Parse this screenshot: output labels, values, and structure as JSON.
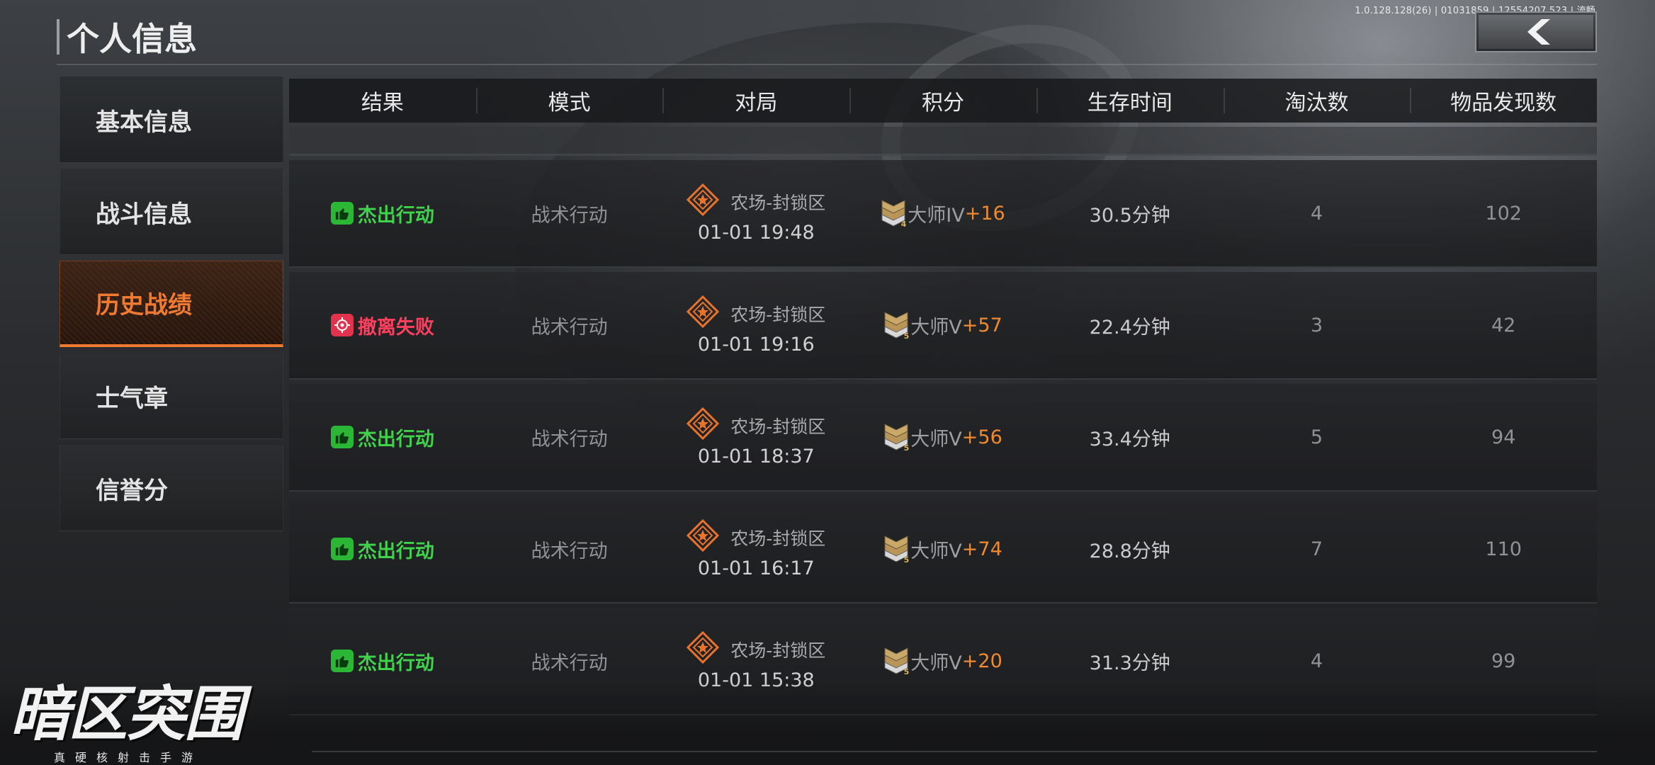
{
  "version_text": "1.0.128.128(26) | 01031859 | 12554207.523 | 流畅",
  "header": {
    "title": "个人信息"
  },
  "sidebar": {
    "items": [
      {
        "label": "基本信息",
        "active": false
      },
      {
        "label": "战斗信息",
        "active": false
      },
      {
        "label": "历史战绩",
        "active": true
      },
      {
        "label": "士气章",
        "active": false
      },
      {
        "label": "信誉分",
        "active": false
      }
    ]
  },
  "table": {
    "columns": [
      "结果",
      "模式",
      "对局",
      "积分",
      "生存时间",
      "淘汰数",
      "物品发现数"
    ],
    "rows": [
      {
        "result": "杰出行动",
        "result_type": "success",
        "mode": "战术行动",
        "map": "农场-封锁区",
        "time": "01-01 19:48",
        "rank": "大师IV",
        "rank_level": "4",
        "delta": "+16",
        "survival": "30.5分钟",
        "kills": "4",
        "items": "102"
      },
      {
        "result": "撤离失败",
        "result_type": "fail",
        "mode": "战术行动",
        "map": "农场-封锁区",
        "time": "01-01 19:16",
        "rank": "大师V",
        "rank_level": "5",
        "delta": "+57",
        "survival": "22.4分钟",
        "kills": "3",
        "items": "42"
      },
      {
        "result": "杰出行动",
        "result_type": "success",
        "mode": "战术行动",
        "map": "农场-封锁区",
        "time": "01-01 18:37",
        "rank": "大师V",
        "rank_level": "5",
        "delta": "+56",
        "survival": "33.4分钟",
        "kills": "5",
        "items": "94"
      },
      {
        "result": "杰出行动",
        "result_type": "success",
        "mode": "战术行动",
        "map": "农场-封锁区",
        "time": "01-01 16:17",
        "rank": "大师V",
        "rank_level": "5",
        "delta": "+74",
        "survival": "28.8分钟",
        "kills": "7",
        "items": "110"
      },
      {
        "result": "杰出行动",
        "result_type": "success",
        "mode": "战术行动",
        "map": "农场-封锁区",
        "time": "01-01 15:38",
        "rank": "大师V",
        "rank_level": "5",
        "delta": "+20",
        "survival": "31.3分钟",
        "kills": "4",
        "items": "99"
      }
    ]
  },
  "logo": {
    "title": "暗区突围",
    "subtitle": "真硬核射击手游"
  },
  "colors": {
    "accent": "#f07a32",
    "success": "#3ed34a",
    "fail": "#ff3f5e",
    "delta": "#f08a30"
  },
  "icons": {
    "back": "chevron-left-icon",
    "success": "thumbs-up-icon",
    "fail": "target-icon",
    "map": "map-diamond-icon",
    "rank": "rank-chevron-icon"
  }
}
